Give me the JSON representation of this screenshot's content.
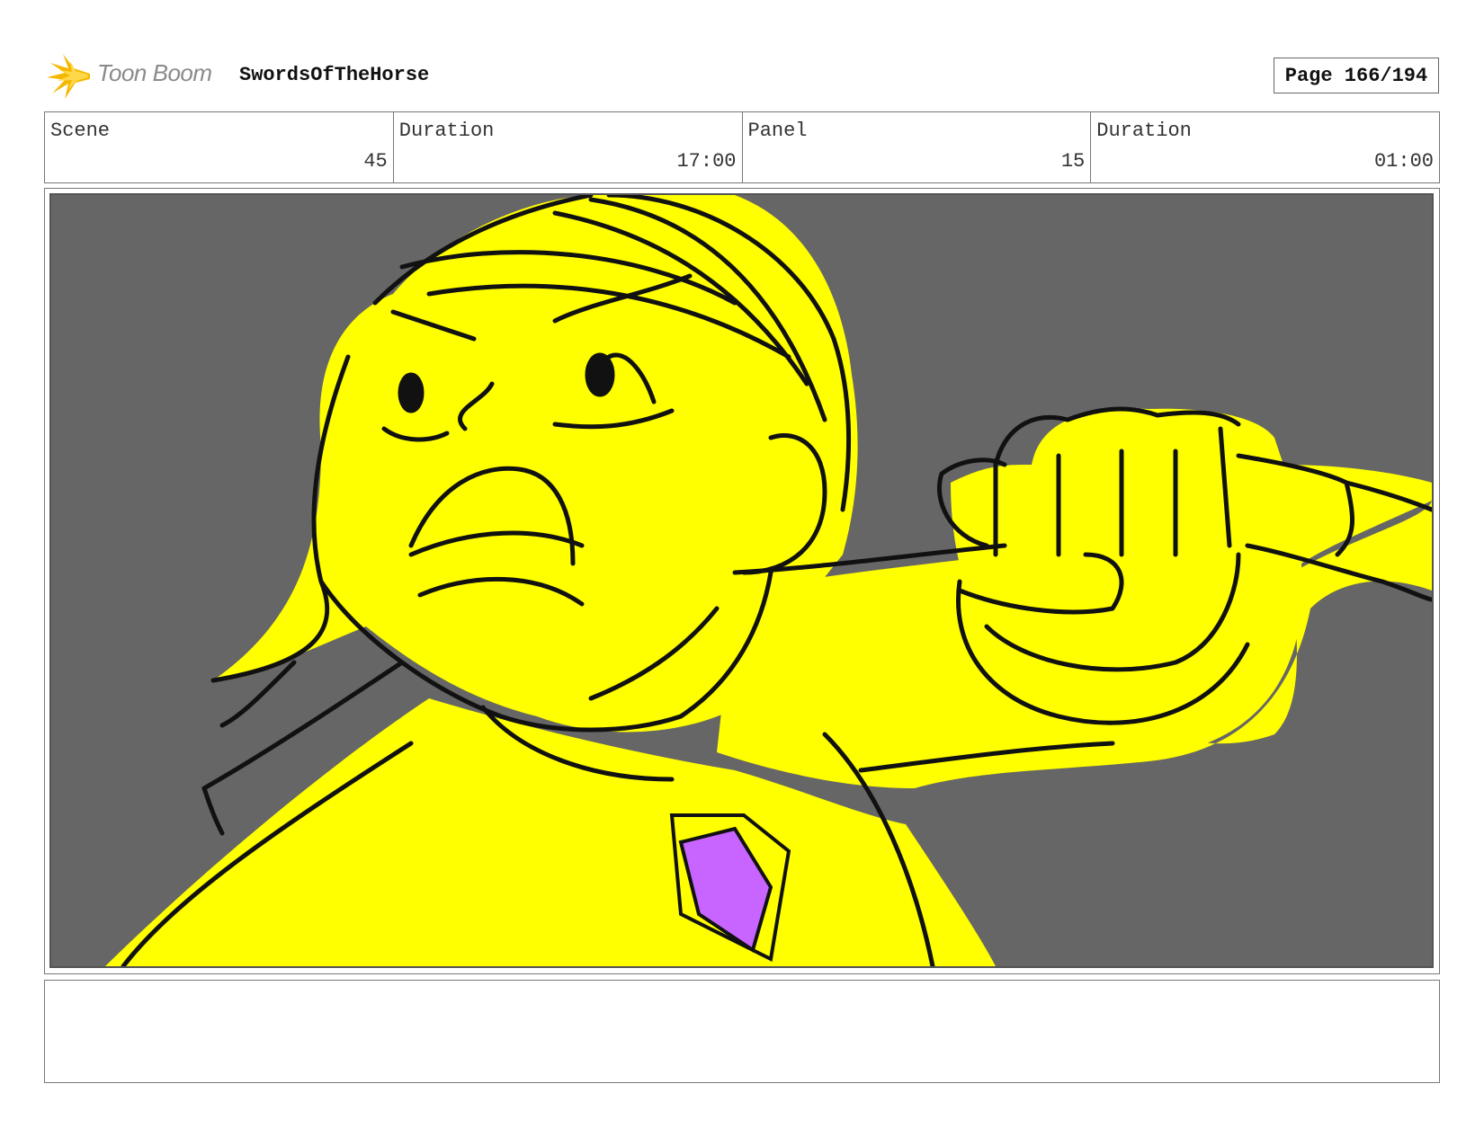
{
  "header": {
    "logo_text": "Toon Boom",
    "project_title": "SwordsOfTheHorse",
    "page_label": "Page 166/194"
  },
  "info": {
    "scene_label": "Scene",
    "scene_value": "45",
    "scene_duration_label": "Duration",
    "scene_duration_value": "17:00",
    "panel_label": "Panel",
    "panel_value": "15",
    "panel_duration_label": "Duration",
    "panel_duration_value": "01:00"
  },
  "panel": {
    "background_color": "#666666",
    "fill_color": "#ffff00",
    "gem_color": "#c864ff",
    "line_color": "#111111"
  },
  "notes": {
    "text": ""
  },
  "colors": {
    "logo_accent": "#f5b800",
    "logo_text": "#8a8a8a",
    "border": "#777777"
  }
}
